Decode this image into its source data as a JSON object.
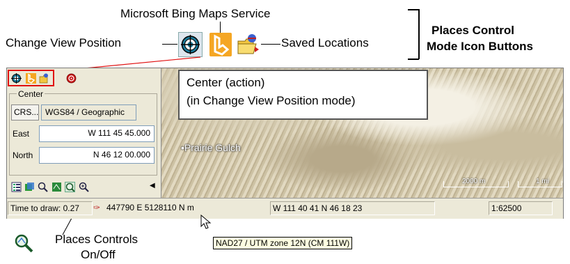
{
  "annotations": {
    "bing_label": "Microsoft Bing Maps Service",
    "change_view_label": "Change View Position",
    "saved_locations_label": "Saved Locations",
    "places_mode_title_line1": "Places Control",
    "places_mode_title_line2": "Mode Icon Buttons",
    "center_action_line1": "Center (action)",
    "center_action_line2": "(in Change View Position mode)",
    "places_onoff_line1": "Places Controls",
    "places_onoff_line2": "On/Off"
  },
  "panel": {
    "group_label": "Center",
    "crs_button": "CRS...",
    "crs_value": "WGS84 / Geographic",
    "east_label": "East",
    "east_value": "W 111 45 45.000",
    "north_label": "North",
    "north_value": "N 46 12 00.000"
  },
  "map": {
    "place_label": "Prairie Gulch",
    "scale_metric": "2000 m",
    "scale_imperial": "1 mi"
  },
  "status_bar": {
    "time_to_draw": "Time to draw: 0.27",
    "projected_coords": "447790 E  5128110 N m",
    "geo_coords": "W 111 40 41  N 46 18 23",
    "scale": "1:62500"
  },
  "tooltip": "NAD27 / UTM zone 12N (CM 111W)",
  "colors": {
    "highlight_red": "#e01010",
    "bing_orange": "#f5a623",
    "tooltip_bg": "#ffffe1"
  }
}
